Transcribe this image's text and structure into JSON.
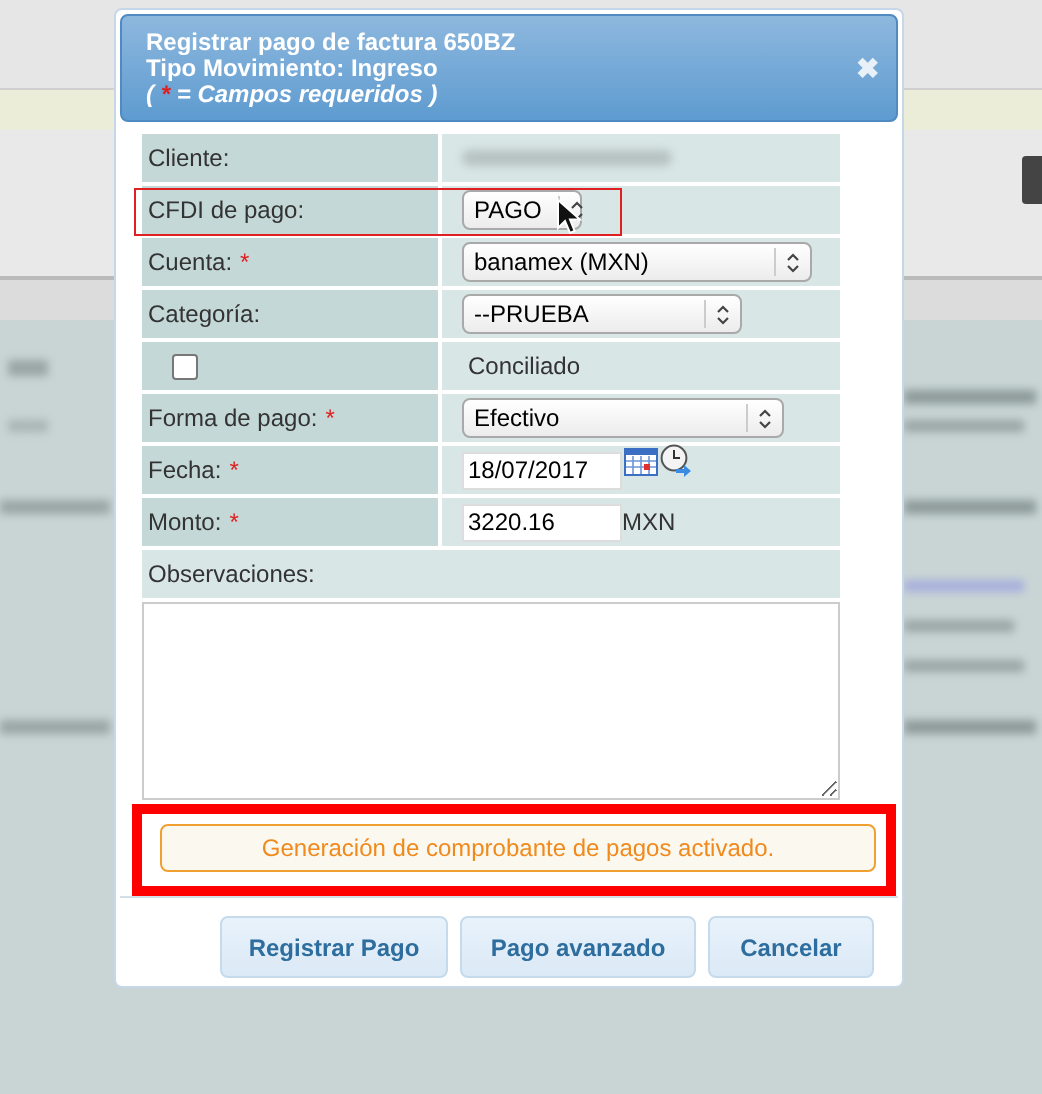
{
  "dialog": {
    "title_lines": [
      "Registrar pago de factura 650BZ",
      "Tipo Movimiento: Ingreso"
    ],
    "legend": {
      "open": "(",
      "mark": "*",
      "text": "= Campos requeridos )"
    },
    "close_label": "✖",
    "fields": [
      {
        "kind": "blurred",
        "label": "Cliente:",
        "required": false,
        "highlighted": false
      },
      {
        "kind": "select",
        "label": "CFDI de pago:",
        "value": "PAGO",
        "required": false,
        "highlighted": true
      },
      {
        "kind": "select",
        "label": "Cuenta:",
        "value": "banamex (MXN)",
        "required": true,
        "highlighted": false
      },
      {
        "kind": "select",
        "label": "Categoría:",
        "value": "--PRUEBA",
        "required": false,
        "highlighted": false
      },
      {
        "kind": "checkbox",
        "label": "Conciliado",
        "checked": false,
        "highlighted": false
      },
      {
        "kind": "select",
        "label": "Forma de pago:",
        "value": "Efectivo",
        "required": true,
        "highlighted": false
      },
      {
        "kind": "date",
        "label": "Fecha:",
        "value": "18/07/2017",
        "required": true,
        "highlighted": false
      },
      {
        "kind": "amount",
        "label": "Monto:",
        "value": "3220.16",
        "unit": "MXN",
        "required": true,
        "highlighted": false
      }
    ],
    "notes_label": "Observaciones:",
    "notice": {
      "text": "Generación de comprobante de pagos activado.",
      "highlighted": true
    },
    "buttons": [
      "Registrar Pago",
      "Pago avanzado",
      "Cancelar"
    ]
  }
}
